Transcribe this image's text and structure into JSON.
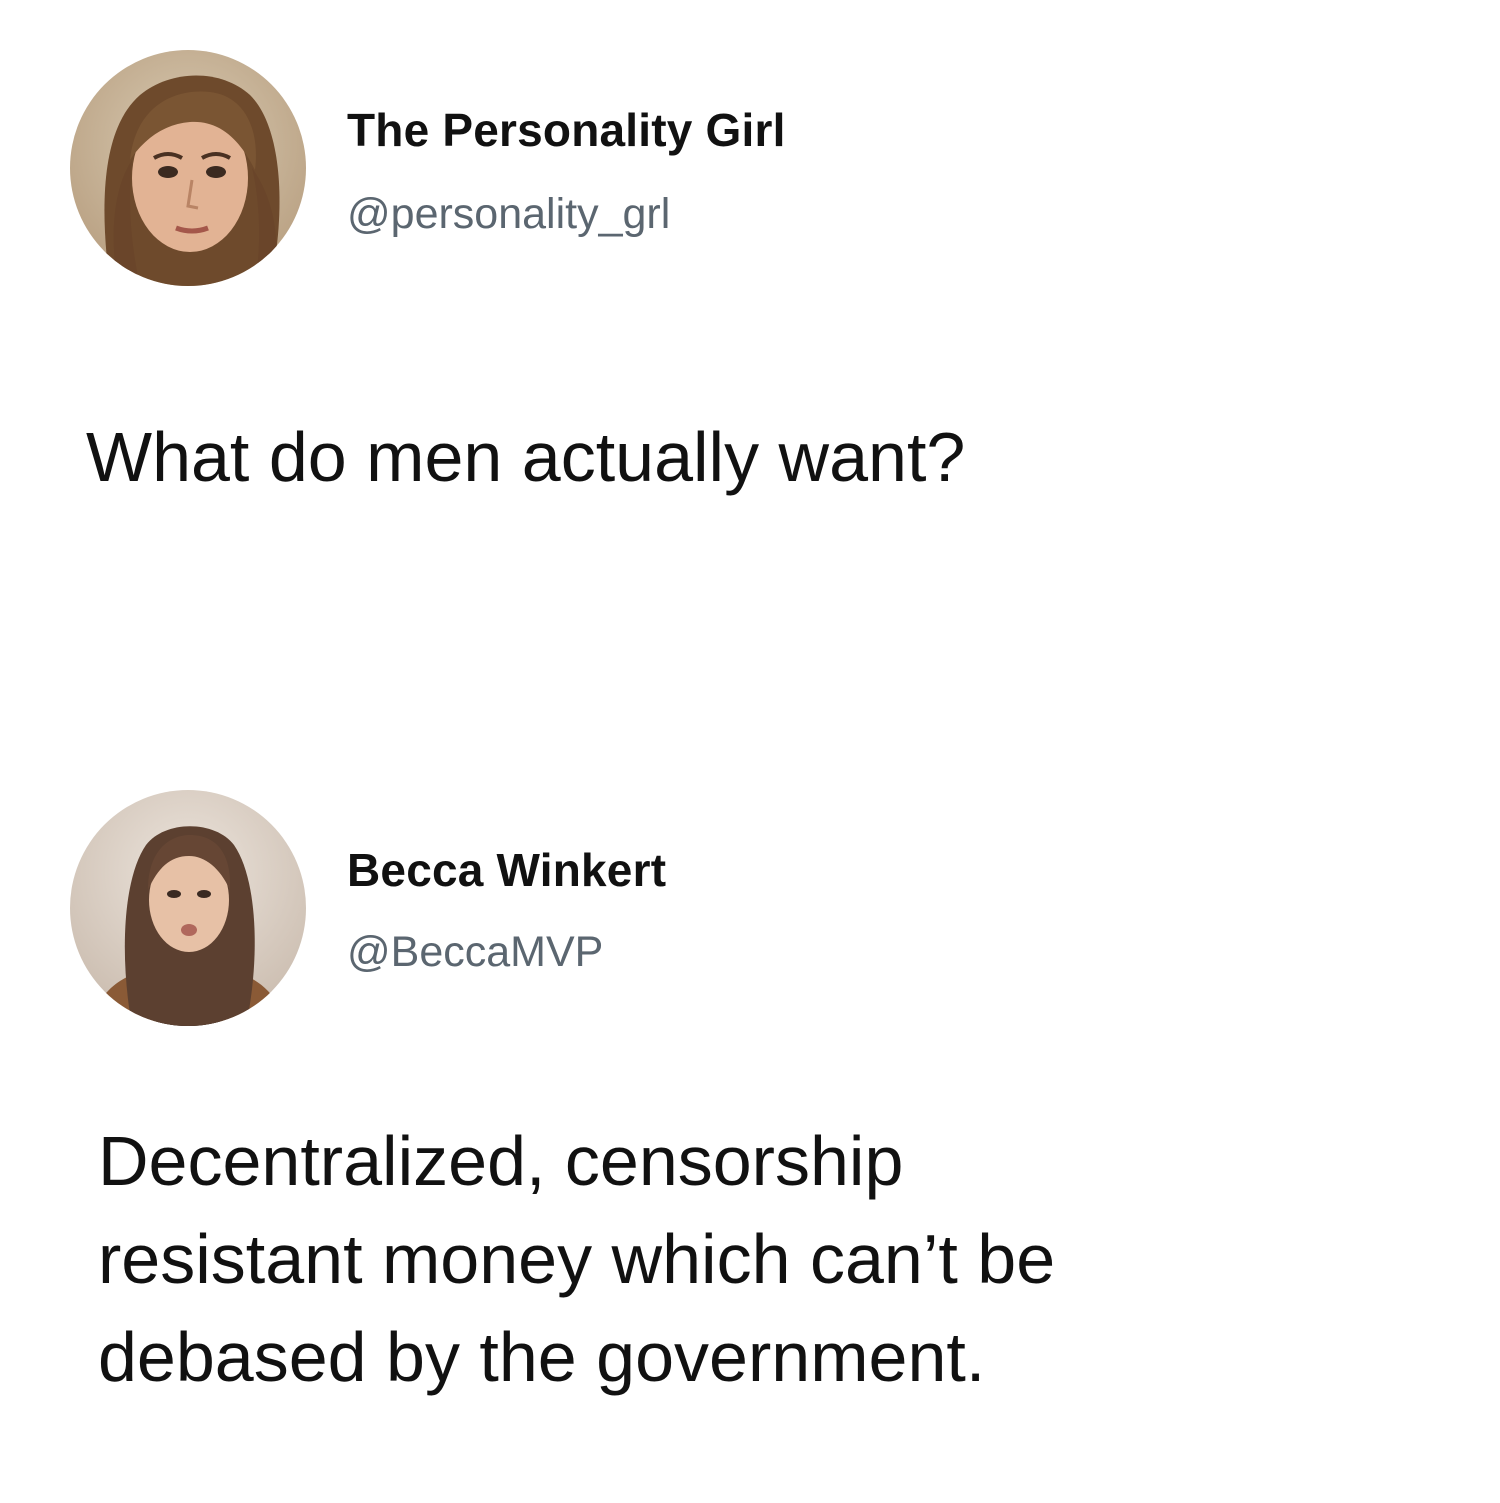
{
  "tweets": [
    {
      "author": {
        "display_name": "The Personality Girl",
        "handle": "@personality_grl",
        "avatar_icon": "profile-photo-woman-brown-hair"
      },
      "text": "What do men actually want?"
    },
    {
      "author": {
        "display_name": "Becca Winkert",
        "handle": "@BeccaMVP",
        "avatar_icon": "profile-photo-woman-long-hair"
      },
      "text_lines": [
        "Decentralized, censorship",
        "resistant money which can’t be",
        "debased by the government."
      ]
    }
  ],
  "colors": {
    "text": "#111111",
    "handle": "#5b6670",
    "background": "#ffffff"
  }
}
